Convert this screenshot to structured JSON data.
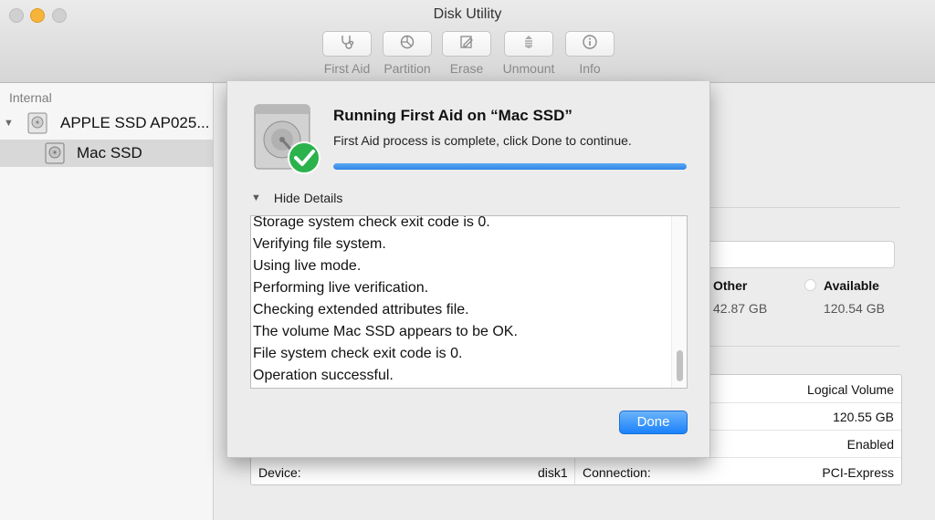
{
  "window": {
    "title": "Disk Utility"
  },
  "toolbar": {
    "items": [
      {
        "label": "First Aid",
        "icon": "stethoscope-icon"
      },
      {
        "label": "Partition",
        "icon": "pie-partition-icon"
      },
      {
        "label": "Erase",
        "icon": "erase-icon"
      },
      {
        "label": "Unmount",
        "icon": "unmount-icon"
      },
      {
        "label": "Info",
        "icon": "info-icon"
      }
    ]
  },
  "sidebar": {
    "section": "Internal",
    "items": [
      {
        "label": "APPLE SSD AP025...",
        "icon": "hard-disk-icon",
        "selected": false
      },
      {
        "label": "Mac SSD",
        "icon": "volume-icon",
        "selected": true
      }
    ]
  },
  "main": {
    "stats": [
      {
        "label": "Other",
        "value": "42.87 GB"
      },
      {
        "label": "Available",
        "value": "120.54 GB"
      }
    ],
    "info_rows": [
      {
        "left_label": "",
        "left_value": "",
        "right_label": "",
        "right_value": "Logical Volume"
      },
      {
        "left_label": "",
        "left_value": "",
        "right_label": "",
        "right_value": "120.55 GB"
      },
      {
        "left_label": "",
        "left_value": "",
        "right_label": "",
        "right_value": "Enabled"
      },
      {
        "left_label": "Device:",
        "left_value": "disk1",
        "right_label": "Connection:",
        "right_value": "PCI-Express"
      }
    ]
  },
  "dialog": {
    "title": "Running First Aid on “Mac SSD”",
    "message": "First Aid process is complete, click Done to continue.",
    "progress": 1.0,
    "details_toggle": "Hide Details",
    "log_lines": [
      "Storage system check exit code is 0.",
      "Verifying file system.",
      "Using live mode.",
      "Performing live verification.",
      "Checking extended attributes file.",
      "The volume Mac SSD appears to be OK.",
      "File system check exit code is 0.",
      "Operation successful."
    ],
    "done_label": "Done"
  },
  "colors": {
    "accent": "#2f86e6",
    "success": "#2bb24c",
    "button": "#1a82fb"
  }
}
